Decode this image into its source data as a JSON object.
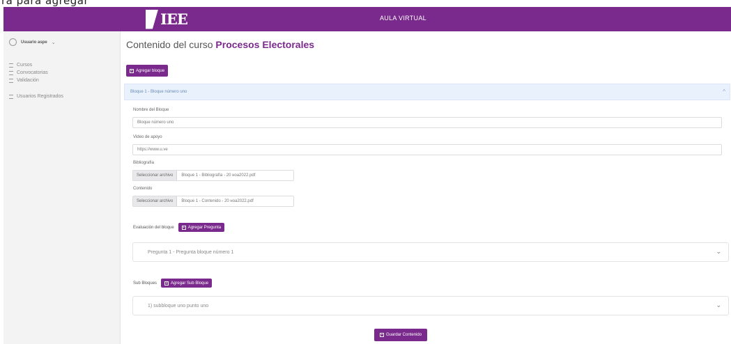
{
  "top_text": "ra para agregar",
  "navbar": {
    "logo_text": "IEE",
    "title": "AULA VIRTUAL"
  },
  "sidebar": {
    "user_name": "Usuario aspe",
    "menu": [
      "Cursos",
      "Convocatorias",
      "Validación",
      "Usuarios Registrados"
    ]
  },
  "main": {
    "title_prefix": "Contenido del curso",
    "course_name": "Procesos Electorales",
    "add_block_label": "Agregar bloque",
    "block_header": "Bloque 1 - Bloque número uno",
    "fields": {
      "name_label": "Nombre del Bloque",
      "name_value": "Bloque número uno",
      "video_label": "Video de apoyo",
      "video_value": "https://www.u.ve",
      "bibliography_label": "Bibliografía",
      "bibliography_choose": "Seleccionar archivo",
      "bibliography_file": "Bloque 1 - Bibliografía - 20 нoa2022.pdf",
      "content_label": "Contenido",
      "content_choose": "Seleccionar archivo",
      "content_file": "Bloque 1 - Contenido - 20 нoa2022.pdf"
    },
    "evaluation_label": "Evaluación del bloque",
    "add_question_label": "Agregar Pregunta",
    "question_item": "Pregunta 1 - Pregunta bloque número 1",
    "subblocks_label": "Sub Bloques",
    "add_subblock_label": "Agregar Sub Bloque",
    "subblock_item": "1) subbloque uno punto uno",
    "save_label": "Guardar Contenido"
  }
}
